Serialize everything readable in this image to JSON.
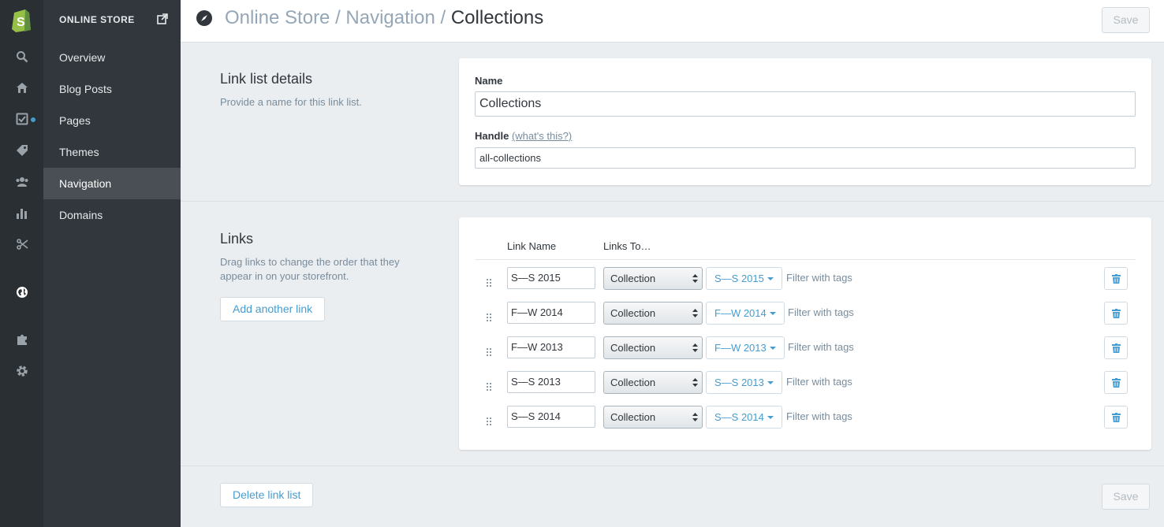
{
  "sidebar": {
    "header": "ONLINE STORE",
    "items": [
      {
        "label": "Overview"
      },
      {
        "label": "Blog Posts"
      },
      {
        "label": "Pages"
      },
      {
        "label": "Themes"
      },
      {
        "label": "Navigation",
        "active": true
      },
      {
        "label": "Domains"
      }
    ]
  },
  "rail": {
    "icons": [
      "shopify-logo-icon",
      "search-icon",
      "home-icon",
      "orders-icon",
      "tag-icon",
      "customers-icon",
      "reports-icon",
      "discounts-icon",
      "online-store-icon",
      "apps-icon",
      "settings-icon"
    ]
  },
  "header": {
    "crumb_1": "Online Store",
    "crumb_2": "Navigation",
    "separator": "/",
    "current": "Collections",
    "save_label": "Save"
  },
  "details": {
    "title": "Link list details",
    "description": "Provide a name for this link list.",
    "name_label": "Name",
    "name_value": "Collections",
    "handle_label": "Handle",
    "handle_help": "(what's this?)",
    "handle_value": "all-collections"
  },
  "links": {
    "title": "Links",
    "description": "Drag links to change the order that they appear in on your storefront.",
    "add_label": "Add another link",
    "col_name": "Link Name",
    "col_to": "Links To…",
    "rows": [
      {
        "name": "S—S 2015",
        "type": "Collection",
        "target": "S—S 2015",
        "filter": "Filter with tags"
      },
      {
        "name": "F—W 2014",
        "type": "Collection",
        "target": "F—W 2014",
        "filter": "Filter with tags"
      },
      {
        "name": "F—W 2013",
        "type": "Collection",
        "target": "F—W 2013",
        "filter": "Filter with tags"
      },
      {
        "name": "S—S 2013",
        "type": "Collection",
        "target": "S—S 2013",
        "filter": "Filter with tags"
      },
      {
        "name": "S—S 2014",
        "type": "Collection",
        "target": "S—S 2014",
        "filter": "Filter with tags"
      }
    ]
  },
  "footer": {
    "delete_label": "Delete link list",
    "save_label": "Save"
  },
  "colors": {
    "accent": "#479ccf",
    "rail_bg": "#2a2f33",
    "subnav_bg": "#31373d",
    "active_bg": "#494f55",
    "logo_green": "#95bf47"
  }
}
